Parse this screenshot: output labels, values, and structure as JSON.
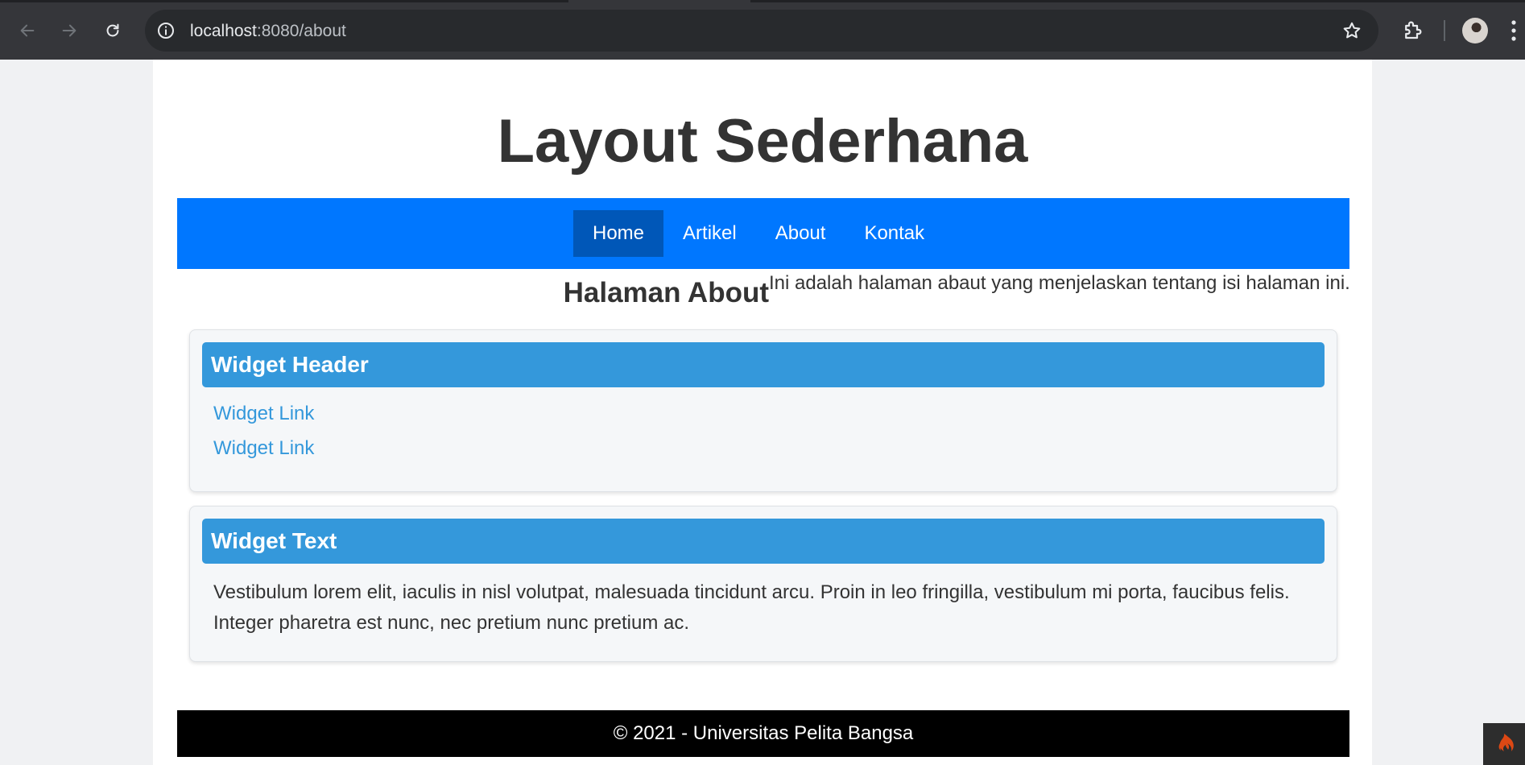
{
  "browser": {
    "url_host": "localhost",
    "url_rest": ":8080/about"
  },
  "site": {
    "title": "Layout Sederhana",
    "nav": [
      "Home",
      "Artikel",
      "About",
      "Kontak"
    ],
    "active_nav": "Home"
  },
  "content": {
    "heading": "Halaman About",
    "text": "Ini adalah halaman abaut yang menjelaskan tentang isi halaman ini."
  },
  "widgets": [
    {
      "header": "Widget Header",
      "links": [
        "Widget Link",
        "Widget Link"
      ]
    },
    {
      "header": "Widget Text",
      "text": "Vestibulum lorem elit, iaculis in nisl volutpat, malesuada tincidunt arcu. Proin in leo fringilla, vestibulum mi porta, faucibus felis. Integer pharetra est nunc, nec pretium nunc pretium ac."
    }
  ],
  "footer": {
    "text": "© 2021 - Universitas Pelita Bangsa"
  },
  "colors": {
    "navbar": "#0077ff",
    "nav_active": "#0057b8",
    "widget_header": "#3498db",
    "link": "#3498db",
    "footer": "#000000"
  },
  "icons": [
    "back-arrow-icon",
    "forward-arrow-icon",
    "reload-icon",
    "site-info-icon",
    "bookmark-star-icon",
    "extensions-puzzle-icon",
    "profile-avatar",
    "kebab-menu-icon",
    "codeigniter-flame-icon"
  ]
}
